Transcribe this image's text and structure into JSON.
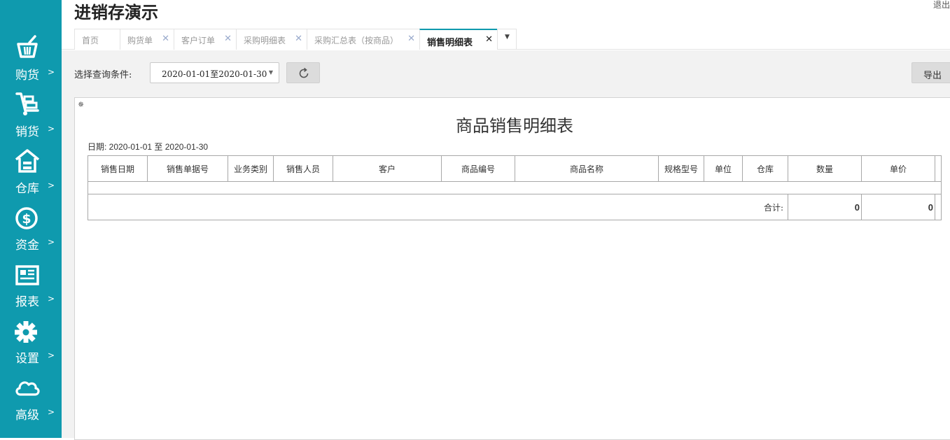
{
  "app": {
    "title": "进销存演示",
    "logout_label": "退出"
  },
  "sidebar": {
    "items": [
      {
        "label": "购货",
        "arrow": ">",
        "icon": "basket-icon"
      },
      {
        "label": "销货",
        "arrow": ">",
        "icon": "hand-truck-icon"
      },
      {
        "label": "仓库",
        "arrow": ">",
        "icon": "warehouse-icon"
      },
      {
        "label": "资金",
        "arrow": ">",
        "icon": "dollar-circle-icon"
      },
      {
        "label": "报表",
        "arrow": ">",
        "icon": "report-icon"
      },
      {
        "label": "设置",
        "arrow": ">",
        "icon": "gear-icon"
      },
      {
        "label": "高级",
        "arrow": ">",
        "icon": "cloud-icon"
      }
    ]
  },
  "tabs": [
    {
      "label": "首页",
      "closable": false
    },
    {
      "label": "购货单",
      "closable": true
    },
    {
      "label": "客户订单",
      "closable": true
    },
    {
      "label": "采购明细表",
      "closable": true
    },
    {
      "label": "采购汇总表（按商品）",
      "closable": true
    },
    {
      "label": "销售明细表",
      "closable": true,
      "active": true
    }
  ],
  "tab_close_glyph": "✕",
  "tab_more_glyph": "▼",
  "filter": {
    "label": "选择查询条件:",
    "date_range": "2020-01-01至2020-01-30",
    "arrow": "▼",
    "export_label": "导出"
  },
  "report": {
    "gear_glyph": "✵",
    "title": "商品销售明细表",
    "date_line": "日期: 2020-01-01 至 2020-01-30",
    "columns": [
      "销售日期",
      "销售单据号",
      "业务类别",
      "销售人员",
      "客户",
      "商品编号",
      "商品名称",
      "规格型号",
      "单位",
      "仓库",
      "数量",
      "单价"
    ],
    "total_label": "合计:",
    "total_quantity": "0",
    "total_price": "0"
  },
  "colors": {
    "sidebar": "#0f9aae",
    "accent": "#0f9aae"
  }
}
